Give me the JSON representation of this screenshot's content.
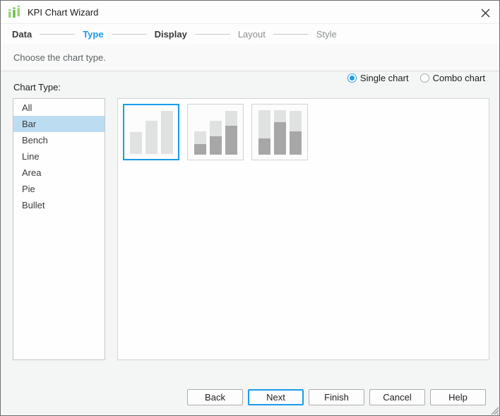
{
  "window": {
    "title": "KPI Chart Wizard"
  },
  "steps": [
    {
      "label": "Data",
      "state": "done"
    },
    {
      "label": "Type",
      "state": "active"
    },
    {
      "label": "Display",
      "state": "done"
    },
    {
      "label": "Layout",
      "state": "upcoming"
    },
    {
      "label": "Style",
      "state": "upcoming"
    }
  ],
  "message": "Choose the chart type.",
  "chart_mode": {
    "options": [
      {
        "label": "Single chart",
        "selected": true
      },
      {
        "label": "Combo chart",
        "selected": false
      }
    ]
  },
  "chart_type": {
    "label": "Chart Type:",
    "options": [
      "All",
      "Bar",
      "Bench",
      "Line",
      "Area",
      "Pie",
      "Bullet"
    ],
    "selected": "Bar"
  },
  "thumbnails": [
    {
      "name": "bar-chart",
      "selected": true,
      "bars": [
        {
          "total": 31,
          "dark": 0
        },
        {
          "total": 47,
          "dark": 0
        },
        {
          "total": 61,
          "dark": 0
        }
      ]
    },
    {
      "name": "stacked-bar-ascending",
      "selected": false,
      "bars": [
        {
          "total": 33,
          "dark": 15
        },
        {
          "total": 48,
          "dark": 26
        },
        {
          "total": 62,
          "dark": 41
        }
      ]
    },
    {
      "name": "stacked-bar-full",
      "selected": false,
      "bars": [
        {
          "total": 63,
          "dark": 23
        },
        {
          "total": 63,
          "dark": 46
        },
        {
          "total": 62,
          "dark": 33
        }
      ]
    }
  ],
  "footer": {
    "buttons": [
      {
        "label": "Back",
        "default": false
      },
      {
        "label": "Next",
        "default": true
      },
      {
        "label": "Finish",
        "default": false
      },
      {
        "label": "Cancel",
        "default": false
      },
      {
        "label": "Help",
        "default": false
      }
    ]
  },
  "icons": {
    "titlebar": "kpi-chart-icon",
    "close": "close-icon",
    "resize": "resize-grip-icon"
  },
  "colors": {
    "accent": "#1a9ce8",
    "list_selection_bg": "#bcdcf2",
    "bar_light": "#e0e1e1",
    "bar_dark": "#a7a7a7",
    "icon_green_dark": "#67bd44",
    "icon_green_light": "#97d077"
  }
}
